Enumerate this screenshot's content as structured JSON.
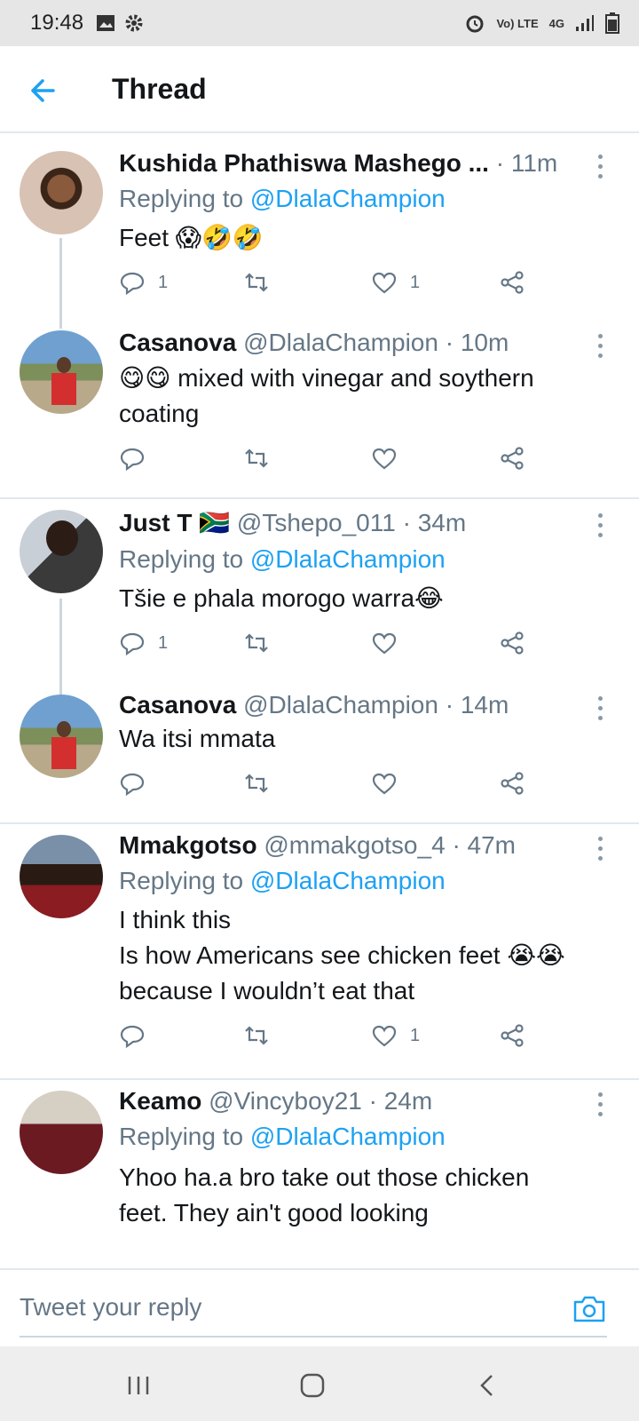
{
  "status_bar": {
    "time": "19:48",
    "network": "4G",
    "volte": "Vo) LTE"
  },
  "header": {
    "title": "Thread"
  },
  "tweets": [
    {
      "name": "Kushida Phathiswa Mashego ...",
      "handle": "",
      "time": "· 11m",
      "replying_label": "Replying to ",
      "replying_handle": "@DlalaChampion",
      "text": "Feet 😱🤣🤣",
      "replies": "1",
      "retweets": "",
      "likes": "1"
    },
    {
      "name": "Casanova",
      "handle": "@DlalaChampion",
      "time": "· 10m",
      "text": "😋😋 mixed with vinegar and soythern coating",
      "replies": "",
      "retweets": "",
      "likes": ""
    },
    {
      "name": "Just T 🇿🇦",
      "handle": "@Tshepo_011",
      "time": "· 34m",
      "replying_label": "Replying to ",
      "replying_handle": "@DlalaChampion",
      "text": "Tšie e phala morogo warra😂",
      "replies": "1",
      "retweets": "",
      "likes": ""
    },
    {
      "name": "Casanova",
      "handle": "@DlalaChampion",
      "time": "· 14m",
      "text": "Wa itsi mmata",
      "replies": "",
      "retweets": "",
      "likes": ""
    },
    {
      "name": "Mmakgotso",
      "handle": "@mmakgotso_4",
      "time": "· 47m",
      "replying_label": "Replying to ",
      "replying_handle": "@DlalaChampion",
      "text_lines": [
        "I think this",
        "Is how Americans see chicken feet 😭😭",
        "because I wouldn’t eat that"
      ],
      "replies": "",
      "retweets": "",
      "likes": "1"
    },
    {
      "name": "Keamo",
      "handle": "@Vincyboy21",
      "time": "· 24m",
      "replying_label": "Replying to ",
      "replying_handle": "@DlalaChampion",
      "text": "Yhoo ha.a bro take out those chicken feet. They ain't good looking"
    }
  ],
  "composer": {
    "placeholder": "Tweet your reply"
  },
  "colors": {
    "accent": "#1da1f2",
    "muted": "#657786",
    "divider": "#e1e8ed"
  }
}
